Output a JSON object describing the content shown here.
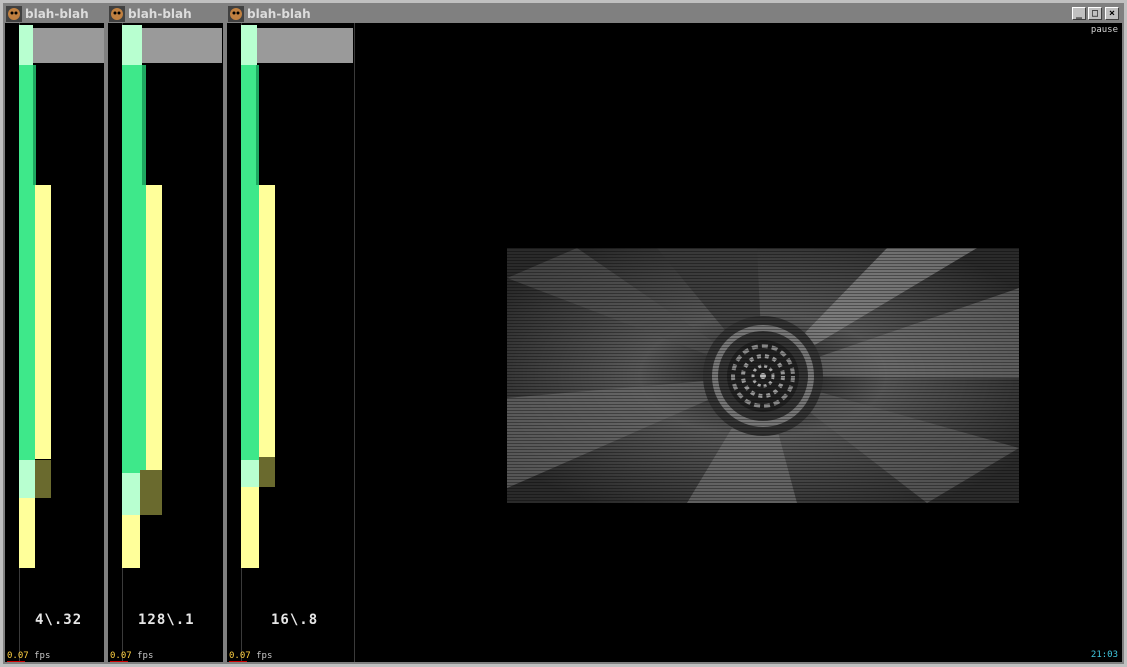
{
  "windows": [
    {
      "title": "blah-blah",
      "ratio": "4\\.32",
      "fps_value": "0.07",
      "fps_unit": "fps"
    },
    {
      "title": "blah-blah",
      "ratio": "128\\.1",
      "fps_value": "0.07",
      "fps_unit": "fps"
    },
    {
      "title": "blah-blah",
      "ratio": "16\\.8",
      "fps_value": "0.07",
      "fps_unit": "fps"
    }
  ],
  "main": {
    "pause_label": "pause",
    "clock": "21:03",
    "minimize_icon": "minimize-icon",
    "maximize_icon": "maximize-icon",
    "close_icon": "close-icon"
  },
  "colors": {
    "green": "#3ee88a",
    "light_green": "#b8ffd0",
    "yellow": "#ffff9a",
    "olive": "#6a6a2e",
    "gray_band": "#9a9a9a"
  }
}
